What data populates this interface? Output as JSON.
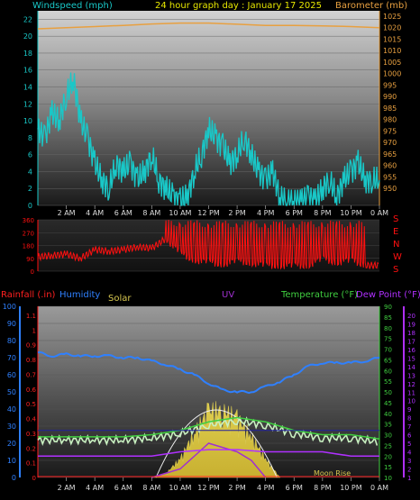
{
  "header": {
    "windspeed_label": "Windspeed (mph)",
    "title": "24 hour graph day : January 17 2025",
    "barometer_label": "Barometer (mb)"
  },
  "bottom_header": {
    "rainfall_label": "Rainfall (.in)",
    "humidity_label": "Humidity",
    "solar_label": "Solar",
    "uv_label": "UV",
    "temperature_label": "Temperature (°F)",
    "dewpoint_label": "Dew Point (°F)"
  },
  "annotations": {
    "moon_rise": "Moon Rise"
  },
  "colors": {
    "wind": "#19c8c8",
    "barometer": "#e8a040",
    "direction": "#ff1010",
    "rain": "#ff2020",
    "humidity": "#2f80ff",
    "solar": "#d8c850",
    "uv": "#a030d0",
    "temperature": "#40d040",
    "dewpoint": "#b030ff",
    "temp_trace": "#c8f0c0"
  },
  "time_ticks": [
    "2 AM",
    "4 AM",
    "6 AM",
    "8 AM",
    "10 AM",
    "12 PM",
    "2 PM",
    "4 PM",
    "6 PM",
    "8 PM",
    "10 PM",
    "0 AM"
  ],
  "chart_data": [
    {
      "type": "line",
      "title": "24 hour graph day : January 17 2025",
      "xlabel": "",
      "ylabel": "Windspeed (mph)",
      "x_range_hours": [
        0,
        24
      ],
      "ylim": [
        0,
        23
      ],
      "yticks_left": [
        "0",
        "2",
        "4",
        "6",
        "8",
        "10",
        "12",
        "14",
        "16",
        "18",
        "20",
        "22"
      ],
      "yticks_right": [
        "950",
        "955",
        "960",
        "965",
        "970",
        "975",
        "980",
        "985",
        "990",
        "995",
        "1000",
        "1005",
        "1010",
        "1015",
        "1020",
        "1025"
      ],
      "series": [
        {
          "name": "Windspeed (mph)",
          "x": [
            0,
            0.5,
            1,
            1.5,
            2,
            2.5,
            3,
            3.5,
            4,
            4.5,
            5,
            5.5,
            6,
            6.5,
            7,
            7.5,
            8,
            8.5,
            9,
            9.5,
            10,
            10.5,
            11,
            11.5,
            12,
            12.5,
            13,
            13.5,
            14,
            14.5,
            15,
            15.5,
            16,
            16.5,
            17,
            17.5,
            18,
            18.5,
            19,
            19.5,
            20,
            20.5,
            21,
            21.5,
            22,
            22.5,
            23,
            23.5,
            24
          ],
          "values": [
            9,
            8,
            11,
            10,
            13,
            15,
            10,
            8,
            5,
            3,
            2,
            5,
            4,
            5,
            3,
            4,
            6,
            3,
            2,
            1,
            0.5,
            1,
            4,
            6,
            9,
            8,
            7,
            5,
            6,
            8,
            6,
            4,
            3,
            4,
            1,
            0.5,
            0.5,
            0.5,
            1,
            0.5,
            2,
            3,
            1,
            3,
            4,
            5,
            3,
            3,
            3
          ]
        },
        {
          "name": "Barometer (mb)",
          "x": [
            0,
            2,
            4,
            6,
            8,
            10,
            12,
            14,
            16,
            18,
            20,
            22,
            24
          ],
          "values": [
            1019.5,
            1020,
            1020.5,
            1021,
            1021.6,
            1022,
            1022,
            1021.5,
            1021,
            1021,
            1020.8,
            1020.5,
            1020
          ]
        }
      ]
    },
    {
      "type": "scatter",
      "title": "",
      "ylabel": "Wind direction",
      "ylim": [
        0,
        360
      ],
      "yticks_left": [
        "0",
        "90",
        "180",
        "270",
        "360"
      ],
      "yticks_right": [
        "N",
        "W",
        "S",
        "E",
        "S"
      ],
      "series": [
        {
          "name": "Wind direction",
          "x": [
            0,
            1,
            2,
            3,
            4,
            5,
            6,
            7,
            8,
            9,
            10,
            11,
            12,
            13,
            14,
            15,
            16,
            17,
            18,
            19,
            20,
            21,
            22,
            23,
            24
          ],
          "values": [
            100,
            110,
            120,
            90,
            150,
            140,
            150,
            170,
            160,
            230,
            120,
            80,
            60,
            50,
            70,
            60,
            40,
            40,
            40,
            40,
            90,
            60,
            80,
            40,
            40
          ]
        }
      ]
    },
    {
      "type": "line",
      "title": "",
      "ylabel": "Humidity",
      "x_range_hours": [
        0,
        24
      ],
      "yticks_humidity": [
        "0",
        "10",
        "20",
        "30",
        "40",
        "50",
        "60",
        "70",
        "80",
        "90",
        "100"
      ],
      "yticks_rain": [
        "0",
        "0.1",
        "0.2",
        "0.3",
        "0.4",
        "0.5",
        "0.6",
        "0.7",
        "0.8",
        "0.9",
        "1",
        "1.1"
      ],
      "yticks_temperature": [
        "10",
        "15",
        "20",
        "25",
        "30",
        "35",
        "40",
        "45",
        "50",
        "55",
        "60",
        "65",
        "70",
        "75",
        "80",
        "85",
        "90"
      ],
      "yticks_dewpoint": [
        "1",
        "2",
        "3",
        "4",
        "5",
        "6",
        "7",
        "8",
        "9",
        "10",
        "11",
        "12",
        "13",
        "14",
        "15",
        "16",
        "17",
        "18",
        "19",
        "20"
      ],
      "series": [
        {
          "name": "Humidity",
          "x": [
            0,
            1,
            2,
            3,
            4,
            5,
            6,
            7,
            8,
            9,
            10,
            11,
            12,
            13,
            14,
            15,
            16,
            17,
            18,
            19,
            20,
            21,
            22,
            23,
            24
          ],
          "values": [
            73,
            71,
            72,
            71,
            71,
            71,
            70,
            70,
            68,
            66,
            63,
            60,
            55,
            51,
            50,
            50,
            53,
            56,
            60,
            65,
            67,
            67,
            67,
            68,
            70
          ]
        },
        {
          "name": "Temperature (°F)",
          "x": [
            0,
            2,
            4,
            6,
            8,
            10,
            12,
            14,
            16,
            18,
            20,
            22,
            24
          ],
          "values": [
            29,
            29,
            29,
            29,
            30,
            32,
            36,
            38,
            36,
            32,
            30,
            30,
            28
          ]
        },
        {
          "name": "Dew Point (°F)",
          "x": [
            0,
            2,
            4,
            6,
            8,
            10,
            12,
            14,
            16,
            18,
            20,
            22,
            24
          ],
          "values": [
            20,
            20,
            20,
            20,
            20,
            22,
            23,
            23,
            22,
            22,
            22,
            20,
            20
          ]
        },
        {
          "name": "Solar",
          "x": [
            8,
            9,
            10,
            11,
            12,
            13,
            14,
            15,
            16,
            17
          ],
          "values": [
            0,
            5,
            25,
            60,
            90,
            90,
            80,
            55,
            25,
            0
          ]
        },
        {
          "name": "UV",
          "x": [
            8,
            10,
            11,
            12,
            13,
            14,
            15,
            16
          ],
          "values": [
            0,
            0.2,
            0.5,
            0.8,
            0.7,
            0.6,
            0.4,
            0
          ]
        },
        {
          "name": "Rainfall (.in)",
          "x": [
            0,
            24
          ],
          "values": [
            0,
            0
          ]
        }
      ]
    }
  ]
}
